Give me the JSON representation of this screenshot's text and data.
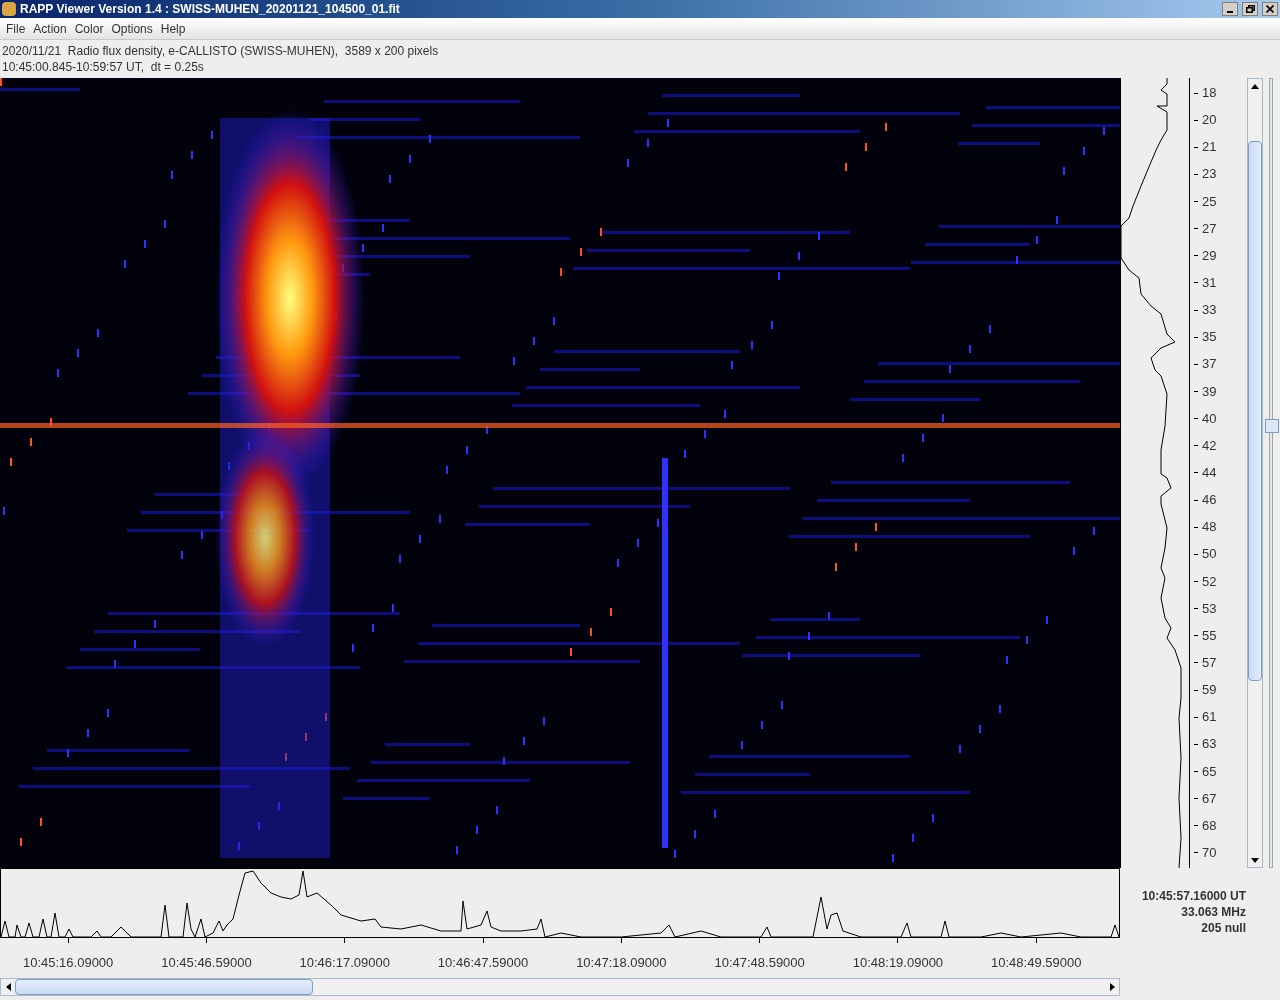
{
  "window": {
    "title": "RAPP Viewer Version 1.4 : SWISS-MUHEN_20201121_104500_01.fit"
  },
  "menu": [
    "File",
    "Action",
    "Color",
    "Options",
    "Help"
  ],
  "info": [
    "2020/11/21  Radio flux density, e-CALLISTO (SWISS-MUHEN),  3589 x 200 pixels",
    "10:45:00.845-10:59:57 UT,  dt = 0.25s"
  ],
  "frequency_axis": [
    "18",
    "20",
    "21",
    "23",
    "25",
    "27",
    "29",
    "31",
    "33",
    "35",
    "37",
    "39",
    "40",
    "42",
    "44",
    "46",
    "48",
    "50",
    "52",
    "53",
    "55",
    "57",
    "59",
    "61",
    "63",
    "65",
    "67",
    "68",
    "70"
  ],
  "slider": {
    "level": 0.56
  },
  "time_axis": [
    "10:45:16.09000",
    "10:45:46.59000",
    "10:46:17.09000",
    "10:46:47.59000",
    "10:47:18.09000",
    "10:47:48.59000",
    "10:48:19.09000",
    "10:48:49.59000"
  ],
  "readout": [
    "10:45:57.16000 UT",
    "33.063 MHz",
    "205 null"
  ]
}
